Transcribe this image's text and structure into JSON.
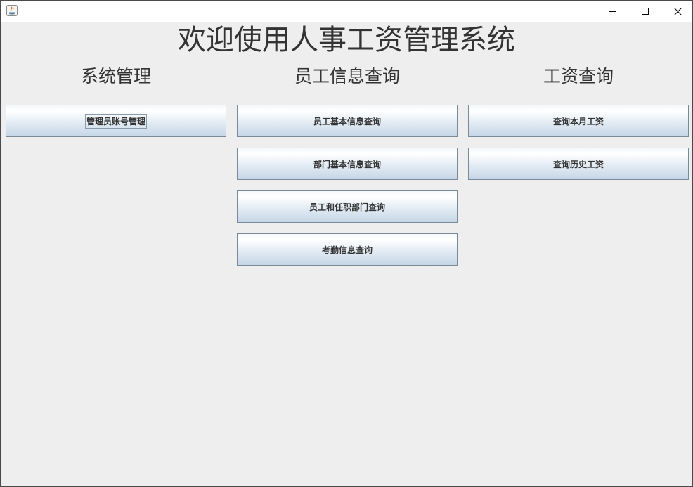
{
  "window": {
    "title": ""
  },
  "main_title": "欢迎使用人事工资管理系统",
  "columns": [
    {
      "heading": "系统管理",
      "buttons": [
        {
          "label": "管理员账号管理",
          "focused": true
        }
      ]
    },
    {
      "heading": "员工信息查询",
      "buttons": [
        {
          "label": "员工基本信息查询"
        },
        {
          "label": "部门基本信息查询"
        },
        {
          "label": "员工和任职部门查询"
        },
        {
          "label": "考勤信息查询"
        }
      ]
    },
    {
      "heading": "工资查询",
      "buttons": [
        {
          "label": "查询本月工资"
        },
        {
          "label": "查询历史工资"
        }
      ]
    }
  ],
  "icons": {
    "app": "java-icon",
    "minimize": "minimize-icon",
    "maximize": "maximize-icon",
    "close": "close-icon"
  },
  "colors": {
    "background": "#eeeeee",
    "button_top": "#ffffff",
    "button_bottom": "#c6d6e6",
    "button_border": "#7a8a99",
    "text": "#333333"
  }
}
